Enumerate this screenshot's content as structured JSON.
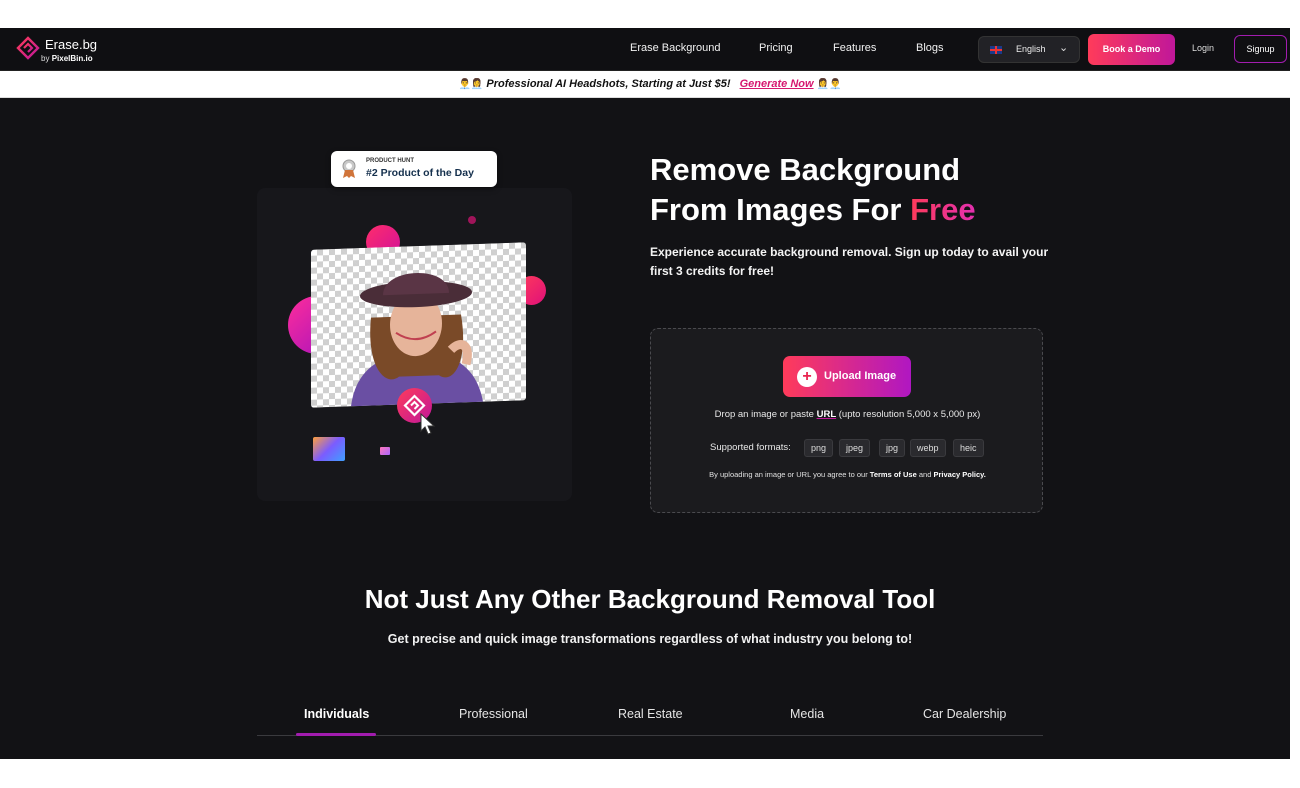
{
  "brand": {
    "title": "Erase.bg",
    "sub_prefix": "by",
    "sub_brand": "PixelBin.io"
  },
  "nav": {
    "links": [
      "Erase Background",
      "Pricing",
      "Features",
      "Blogs"
    ],
    "language": "English",
    "book_demo": "Book a Demo",
    "login": "Login",
    "signup": "Signup"
  },
  "promo": {
    "emoji_left": "👨‍💼👩‍💼",
    "text": "Professional AI Headshots, Starting at Just $5!",
    "cta": "Generate Now",
    "emoji_right": "👩‍💼👨‍💼"
  },
  "badge": {
    "small": "PRODUCT HUNT",
    "main": "#2 Product of the Day"
  },
  "hero": {
    "title_line1": "Remove Background",
    "title_line2": "From Images For",
    "title_free": "Free",
    "subtitle": "Experience accurate background removal. Sign up today to avail your first 3 credits for free!"
  },
  "upload": {
    "button": "Upload Image",
    "drop_prefix": "Drop an image or paste",
    "drop_url": "URL",
    "drop_suffix": "(upto resolution 5,000 x 5,000 px)",
    "formats_label": "Supported formats:",
    "formats": [
      "png",
      "jpeg",
      "jpg",
      "webp",
      "heic"
    ],
    "terms_prefix": "By uploading an image or URL you agree to our",
    "terms_link": "Terms of Use",
    "terms_and": "and",
    "privacy_link": "Privacy Policy."
  },
  "section": {
    "title": "Not Just Any Other Background Removal Tool",
    "subtitle": "Get precise and quick image transformations regardless of what industry you belong to!",
    "tabs": [
      "Individuals",
      "Professional",
      "Real Estate",
      "Media",
      "Car Dealership"
    ],
    "active_tab": "Individuals"
  },
  "colors": {
    "accent_start": "#ff3b5a",
    "accent_end": "#c0179a",
    "bg": "#121215"
  }
}
